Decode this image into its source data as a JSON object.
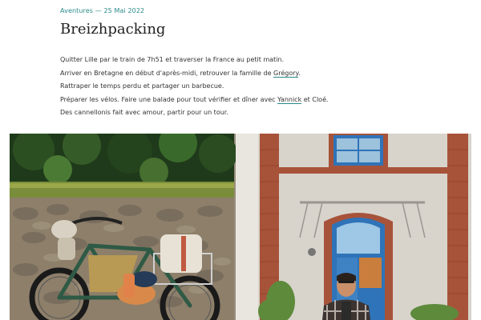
{
  "post": {
    "category": "Aventures",
    "separator": "—",
    "date": "25 Mai 2022",
    "title": "Breizhpacking",
    "paragraphs": [
      {
        "before": "Quitter Lille par le train de 7h51 et traverser la France au petit matin.",
        "link": "",
        "after": ""
      },
      {
        "before": "Arriver en Bretagne en début d'après-midi, retrouver la famille de ",
        "link": "Grégory",
        "after": "."
      },
      {
        "before": "Rattraper le temps perdu et partager un barbecue.",
        "link": "",
        "after": ""
      },
      {
        "before": "Préparer les vélos. Faire une balade pour tout vérifier et dîner avec ",
        "link": "Yannick",
        "after": " et Cloé."
      },
      {
        "before": "Des cannellonis fait avec amour, partir pour un tour.",
        "link": "",
        "after": ""
      }
    ]
  },
  "colors": {
    "accent": "#2a8a8a",
    "text": "#333333",
    "heading": "#222222",
    "door_blue": "#2f73b8",
    "brick": "#a7533a"
  },
  "photos": [
    {
      "subject": "loaded touring bicycle in front of a stone wall and trees"
    },
    {
      "subject": "man in sunglasses and checked shirt in front of a building with a blue door"
    }
  ]
}
